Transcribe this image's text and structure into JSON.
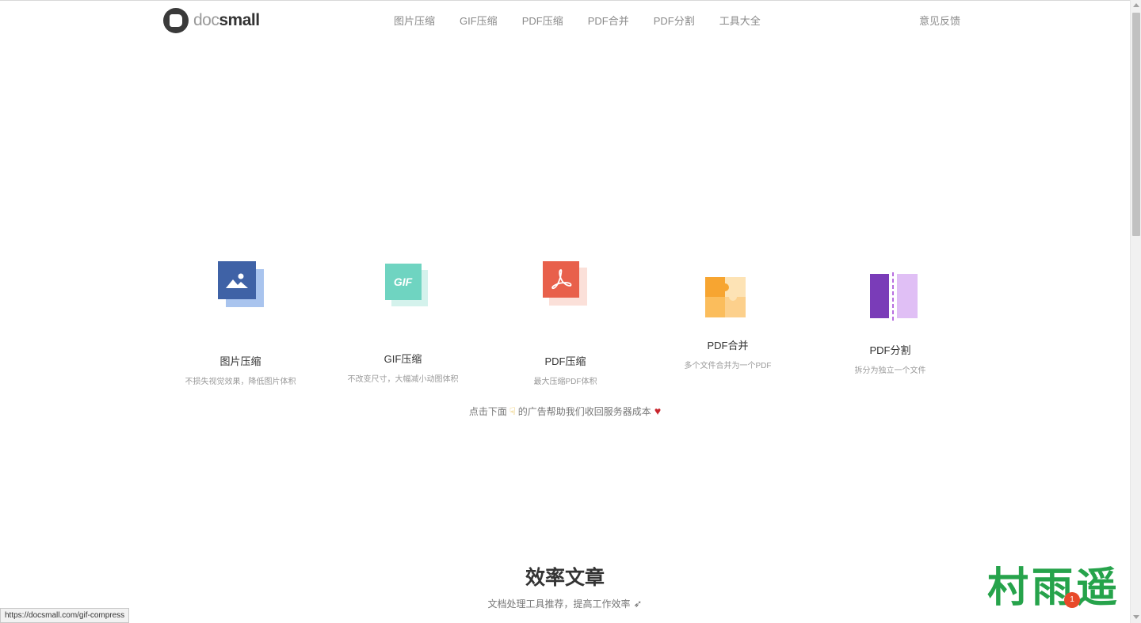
{
  "header": {
    "logo": {
      "doc": "doc",
      "small": "small"
    },
    "nav": [
      "图片压缩",
      "GIF压缩",
      "PDF压缩",
      "PDF合并",
      "PDF分割",
      "工具大全"
    ],
    "feedback": "意见反馈"
  },
  "tools": [
    {
      "name": "图片压缩",
      "desc": "不损失视觉效果，降低图片体积",
      "icon": "image-icon"
    },
    {
      "name": "GIF压缩",
      "desc": "不改变尺寸，大幅减小动图体积",
      "icon": "gif-icon",
      "icon_text": "GIF"
    },
    {
      "name": "PDF压缩",
      "desc": "最大压缩PDF体积",
      "icon": "pdf-icon"
    },
    {
      "name": "PDF合并",
      "desc": "多个文件合并为一个PDF",
      "icon": "puzzle-icon"
    },
    {
      "name": "PDF分割",
      "desc": "拆分为独立一个文件",
      "icon": "split-icon"
    }
  ],
  "support": {
    "before": "点击下面",
    "after": "的广告帮助我们收回服务器成本"
  },
  "articles": {
    "title": "效率文章",
    "subtitle": "文档处理工具推荐，提高工作效率"
  },
  "status_url": "https://docsmall.com/gif-compress",
  "watermark": "村雨遥",
  "badge": "1",
  "colors": {
    "image": "#3f62a6",
    "gif": "#6fd4c1",
    "pdf": "#e8604b",
    "merge": "#f7a531",
    "split": "#7a3cb8"
  }
}
